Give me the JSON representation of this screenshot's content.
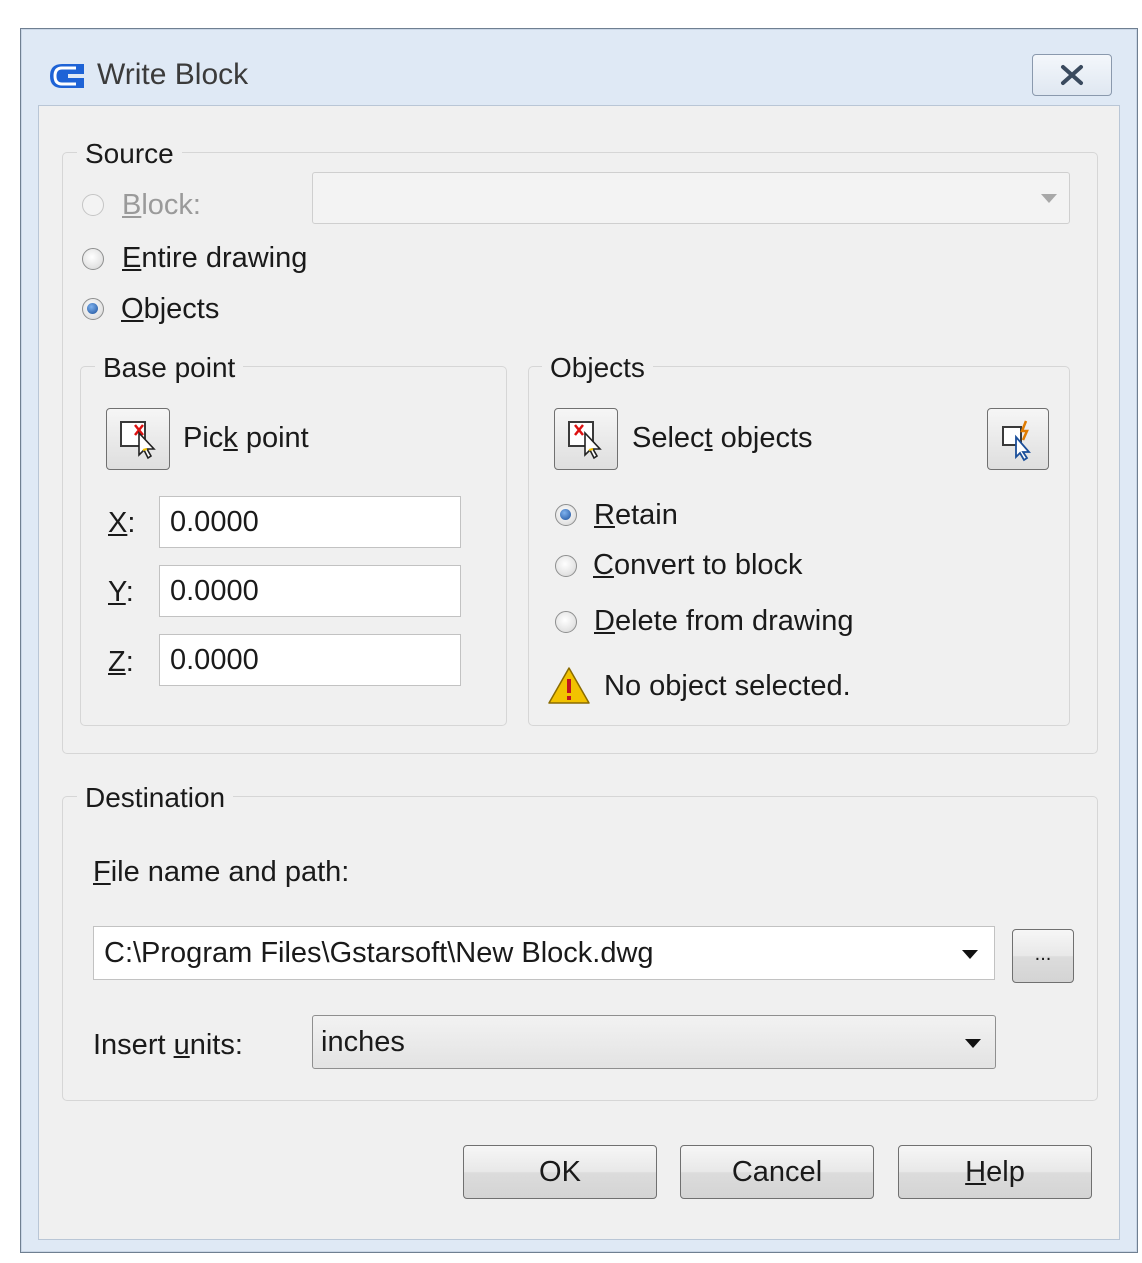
{
  "window": {
    "title": "Write Block"
  },
  "source": {
    "legend": "Source",
    "block_label": "Block:",
    "entire_drawing_label": "Entire drawing",
    "objects_label": "Objects",
    "selected": "objects",
    "base_point": {
      "legend": "Base point",
      "pick_point_label": "Pick point",
      "x_label": "X:",
      "x_value": "0.0000",
      "y_label": "Y:",
      "y_value": "0.0000",
      "z_label": "Z:",
      "z_value": "0.0000"
    },
    "objects_group": {
      "legend": "Objects",
      "select_objects_label": "Select objects",
      "retain_label": "Retain",
      "convert_label": "Convert to block",
      "delete_label": "Delete from drawing",
      "selected_option": "retain",
      "status_text": "No object selected."
    }
  },
  "destination": {
    "legend": "Destination",
    "file_label": "File name and path:",
    "file_value": "C:\\Program Files\\Gstarsoft\\New Block.dwg",
    "browse_label": "...",
    "units_label": "Insert units:",
    "units_value": "inches"
  },
  "buttons": {
    "ok": "OK",
    "cancel": "Cancel",
    "help": "Help"
  },
  "colors": {
    "accent": "#1b4f9a",
    "title_bar": "#dfe9f5",
    "client_bg": "#f0f0f0",
    "warning": "#f2c200"
  }
}
